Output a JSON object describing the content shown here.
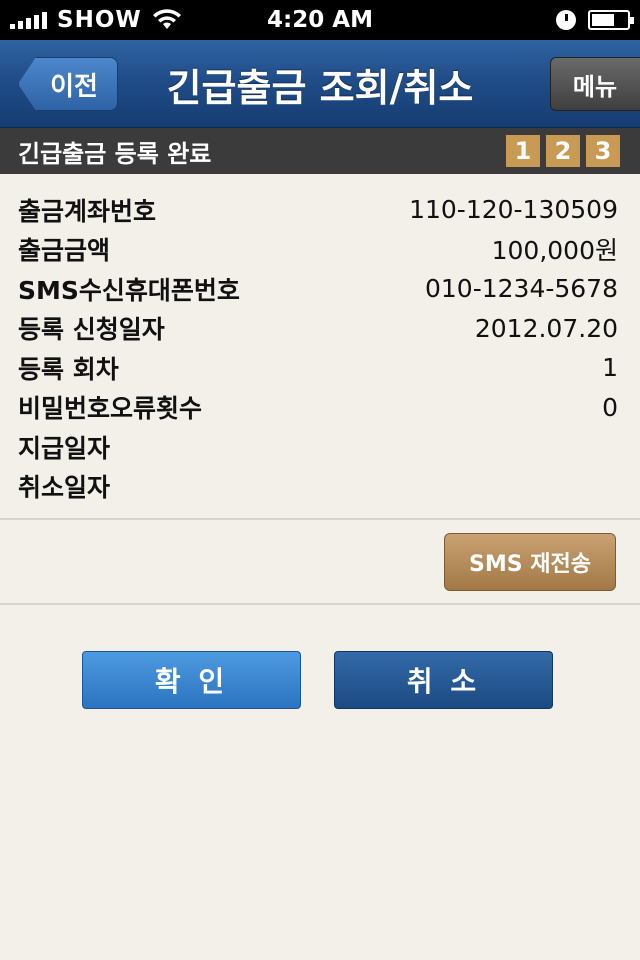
{
  "status_bar": {
    "carrier": "SHOW",
    "time": "4:20 AM",
    "icons": [
      "signal-icon",
      "wifi-icon",
      "clock-icon",
      "battery-icon"
    ]
  },
  "navbar": {
    "back_label": "이전",
    "title": "긴급출금 조회/취소",
    "menu_label": "메뉴"
  },
  "step_header": {
    "title": "긴급출금 등록 완료",
    "steps": [
      "1",
      "2",
      "3"
    ]
  },
  "info_rows": [
    {
      "label": "출금계좌번호",
      "value": "110-120-130509"
    },
    {
      "label": "출금금액",
      "value": "100,000원"
    },
    {
      "label": "SMS수신휴대폰번호",
      "value": "010-1234-5678"
    },
    {
      "label": "등록 신청일자",
      "value": "2012.07.20"
    },
    {
      "label": "등록 회차",
      "value": "1"
    },
    {
      "label": "비밀번호오류횟수",
      "value": "0"
    },
    {
      "label": "지급일자",
      "value": ""
    },
    {
      "label": "취소일자",
      "value": ""
    }
  ],
  "actions": {
    "sms_resend_label": "SMS 재전송",
    "confirm_label": "확 인",
    "cancel_label": "취 소"
  },
  "colors": {
    "background": "#f3efe9",
    "navbar": "#1f4b86",
    "step_badge": "#c89a54",
    "sms_button": "#b58c5c",
    "confirm_button": "#3a86d0",
    "cancel_button": "#245694"
  }
}
